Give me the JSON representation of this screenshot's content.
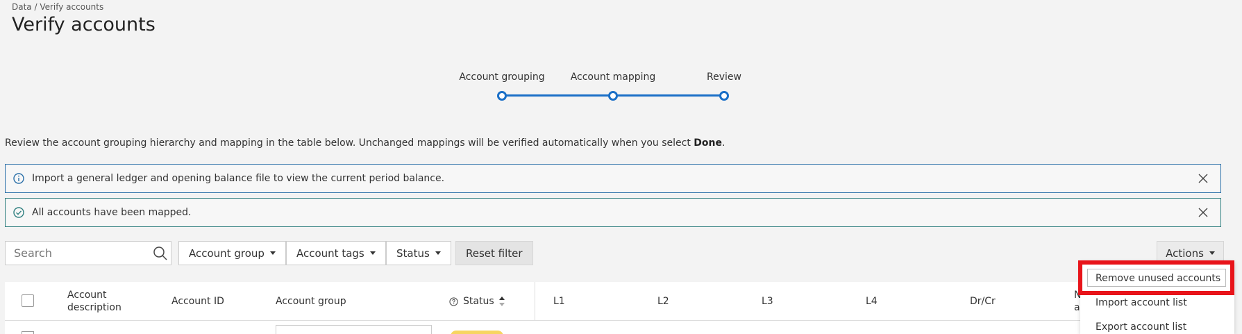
{
  "breadcrumb": "Data / Verify accounts",
  "title": "Verify accounts",
  "stepper": {
    "steps": [
      "Account grouping",
      "Account mapping",
      "Review"
    ]
  },
  "intro": {
    "text": "Review the account grouping hierarchy and mapping in the table below. Unchanged mappings will be verified automatically when you select ",
    "bold": "Done",
    "end": "."
  },
  "banners": {
    "info": "Import a general ledger and opening balance file to view the current period balance.",
    "success": "All accounts have been mapped."
  },
  "toolbar": {
    "search_placeholder": "Search",
    "account_group": "Account group",
    "account_tags": "Account tags",
    "status": "Status",
    "reset_filter": "Reset filter",
    "actions": "Actions"
  },
  "table": {
    "columns": {
      "account_description": "Account description",
      "account_id": "Account ID",
      "account_group": "Account group",
      "status": "Status",
      "l1": "L1",
      "l2": "L2",
      "l3": "L3",
      "l4": "L4",
      "drcr": "Dr/Cr",
      "n_partial": "N a"
    }
  },
  "menu": {
    "items": [
      "Remove unused accounts",
      "Import account list",
      "Export account list"
    ]
  },
  "colors": {
    "accent": "#1a6fc7",
    "info_border": "#2a6fa8",
    "success_border": "#2f7f7f",
    "highlight": "#e8141a",
    "badge": "#f7d560"
  }
}
